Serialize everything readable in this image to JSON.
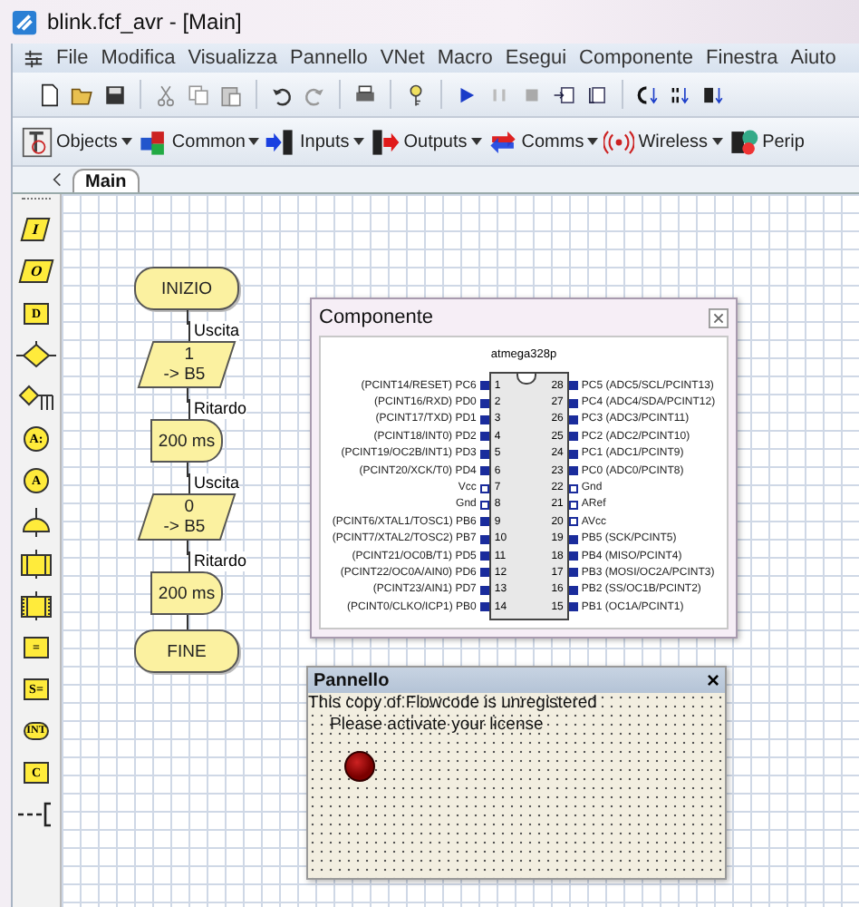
{
  "window": {
    "title": "blink.fcf_avr - [Main]"
  },
  "menu": [
    "File",
    "Modifica",
    "Visualizza",
    "Pannello",
    "VNet",
    "Macro",
    "Esegui",
    "Componente",
    "Finestra",
    "Aiuto"
  ],
  "component_toolbar": [
    "Objects",
    "Common",
    "Inputs",
    "Outputs",
    "Comms",
    "Wireless",
    "Perip"
  ],
  "tabs": [
    {
      "label": "Main",
      "selected": true
    }
  ],
  "palette": [
    {
      "kind": "input",
      "label": "I"
    },
    {
      "kind": "output",
      "label": "O"
    },
    {
      "kind": "delay",
      "label": "D"
    },
    {
      "kind": "decision"
    },
    {
      "kind": "switch"
    },
    {
      "kind": "connection-out",
      "label": "A:"
    },
    {
      "kind": "connection-in",
      "label": "A"
    },
    {
      "kind": "loop"
    },
    {
      "kind": "macro"
    },
    {
      "kind": "component-macro"
    },
    {
      "kind": "calculation",
      "label": "="
    },
    {
      "kind": "string",
      "label": "S="
    },
    {
      "kind": "interrupt",
      "label": "INT"
    },
    {
      "kind": "code",
      "label": "C"
    },
    {
      "kind": "comment"
    }
  ],
  "flowchart": [
    {
      "kind": "terminator",
      "text": [
        "INIZIO"
      ]
    },
    {
      "kind": "output",
      "caption": "Uscita",
      "text": [
        "1",
        "-> B5"
      ]
    },
    {
      "kind": "delay",
      "caption": "Ritardo",
      "text": [
        "200 ms"
      ]
    },
    {
      "kind": "output",
      "caption": "Uscita",
      "text": [
        "0",
        "-> B5"
      ]
    },
    {
      "kind": "delay",
      "caption": "Ritardo",
      "text": [
        "200 ms"
      ]
    },
    {
      "kind": "terminator",
      "text": [
        "FINE"
      ]
    }
  ],
  "component_window": {
    "title": "Componente",
    "chip": "atmega328p",
    "left_pins": [
      {
        "number": "1",
        "label": "(PCINT14/RESET) PC6",
        "kind": "io"
      },
      {
        "number": "2",
        "label": "(PCINT16/RXD) PD0",
        "kind": "io"
      },
      {
        "number": "3",
        "label": "(PCINT17/TXD) PD1",
        "kind": "io"
      },
      {
        "number": "4",
        "label": "(PCINT18/INT0) PD2",
        "kind": "io"
      },
      {
        "number": "5",
        "label": "(PCINT19/OC2B/INT1) PD3",
        "kind": "io"
      },
      {
        "number": "6",
        "label": "(PCINT20/XCK/T0) PD4",
        "kind": "io"
      },
      {
        "number": "7",
        "label": "Vcc",
        "kind": "power"
      },
      {
        "number": "8",
        "label": "Gnd",
        "kind": "power"
      },
      {
        "number": "9",
        "label": "(PCINT6/XTAL1/TOSC1) PB6",
        "kind": "io"
      },
      {
        "number": "10",
        "label": "(PCINT7/XTAL2/TOSC2) PB7",
        "kind": "io"
      },
      {
        "number": "11",
        "label": "(PCINT21/OC0B/T1) PD5",
        "kind": "io"
      },
      {
        "number": "12",
        "label": "(PCINT22/OC0A/AIN0) PD6",
        "kind": "io"
      },
      {
        "number": "13",
        "label": "(PCINT23/AIN1) PD7",
        "kind": "io"
      },
      {
        "number": "14",
        "label": "(PCINT0/CLKO/ICP1) PB0",
        "kind": "io"
      }
    ],
    "right_pins": [
      {
        "number": "28",
        "label": "PC5 (ADC5/SCL/PCINT13)",
        "kind": "io"
      },
      {
        "number": "27",
        "label": "PC4 (ADC4/SDA/PCINT12)",
        "kind": "io"
      },
      {
        "number": "26",
        "label": "PC3 (ADC3/PCINT11)",
        "kind": "io"
      },
      {
        "number": "25",
        "label": "PC2 (ADC2/PCINT10)",
        "kind": "io"
      },
      {
        "number": "24",
        "label": "PC1 (ADC1/PCINT9)",
        "kind": "io"
      },
      {
        "number": "23",
        "label": "PC0 (ADC0/PCINT8)",
        "kind": "io"
      },
      {
        "number": "22",
        "label": "Gnd",
        "kind": "power"
      },
      {
        "number": "21",
        "label": "ARef",
        "kind": "power"
      },
      {
        "number": "20",
        "label": "AVcc",
        "kind": "power"
      },
      {
        "number": "19",
        "label": "PB5 (SCK/PCINT5)",
        "kind": "io"
      },
      {
        "number": "18",
        "label": "PB4 (MISO/PCINT4)",
        "kind": "io"
      },
      {
        "number": "17",
        "label": "PB3 (MOSI/OC2A/PCINT3)",
        "kind": "io"
      },
      {
        "number": "16",
        "label": "PB2 (SS/OC1B/PCINT2)",
        "kind": "io"
      },
      {
        "number": "15",
        "label": "PB1 (OC1A/PCINT1)",
        "kind": "io"
      }
    ]
  },
  "panel_window": {
    "title": "Pannello",
    "close": "×",
    "notice": [
      "This copy of Flowcode is unregistered",
      "Please activate your license"
    ],
    "led": {
      "on": false
    }
  }
}
